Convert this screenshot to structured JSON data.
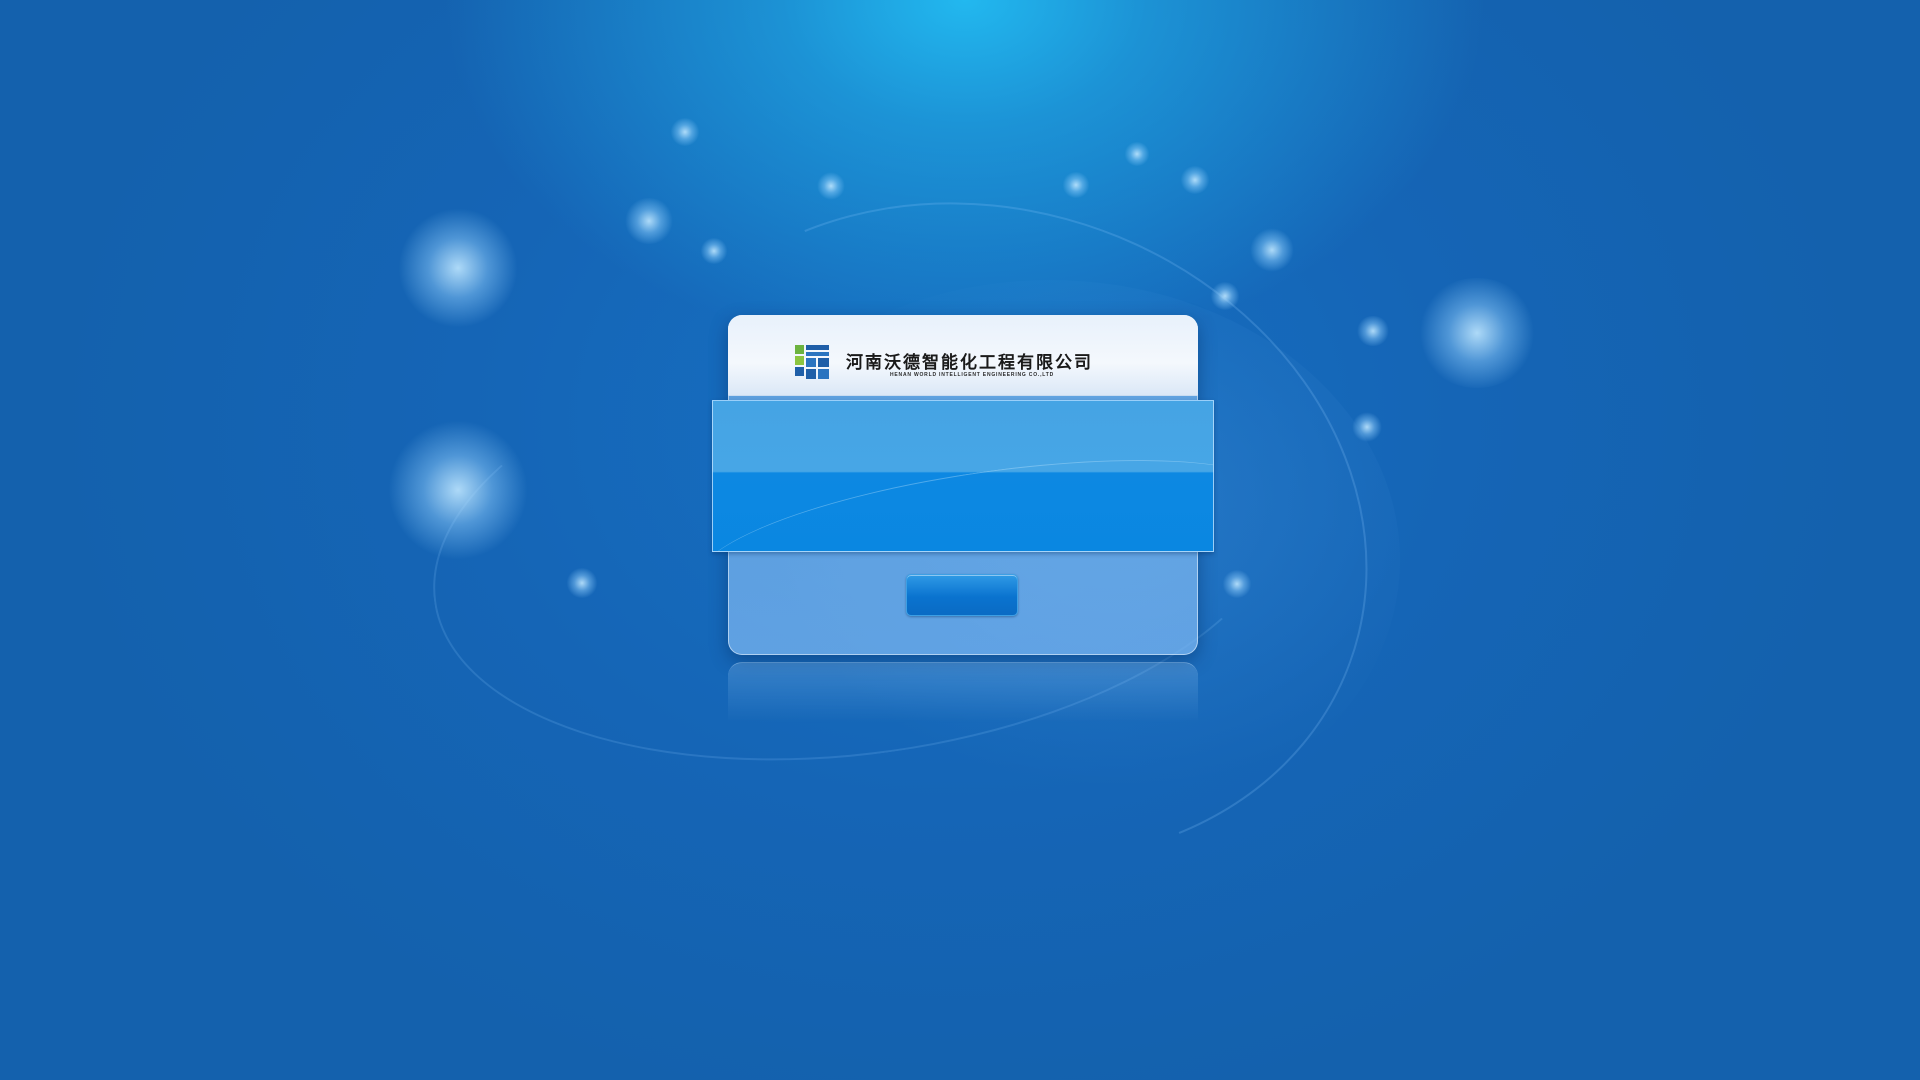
{
  "background": {
    "base_color": "#1461ad",
    "highlight_color": "#22b8ef"
  },
  "login": {
    "company": {
      "logo_icon": "company-logo-icon",
      "name_cn": "河南沃德智能化工程有限公司",
      "name_en": "HENAN WORLD INTELLIGENT ENGINEERING CO.,LTD"
    },
    "username": {
      "value": "",
      "placeholder": ""
    },
    "password": {
      "value": "",
      "placeholder": ""
    },
    "submit_label": ""
  },
  "colors": {
    "header_bg": "#eef4fb",
    "panel_top": "#47a6e6",
    "panel_bottom": "#0a87e1",
    "button": "#0a73cf"
  }
}
